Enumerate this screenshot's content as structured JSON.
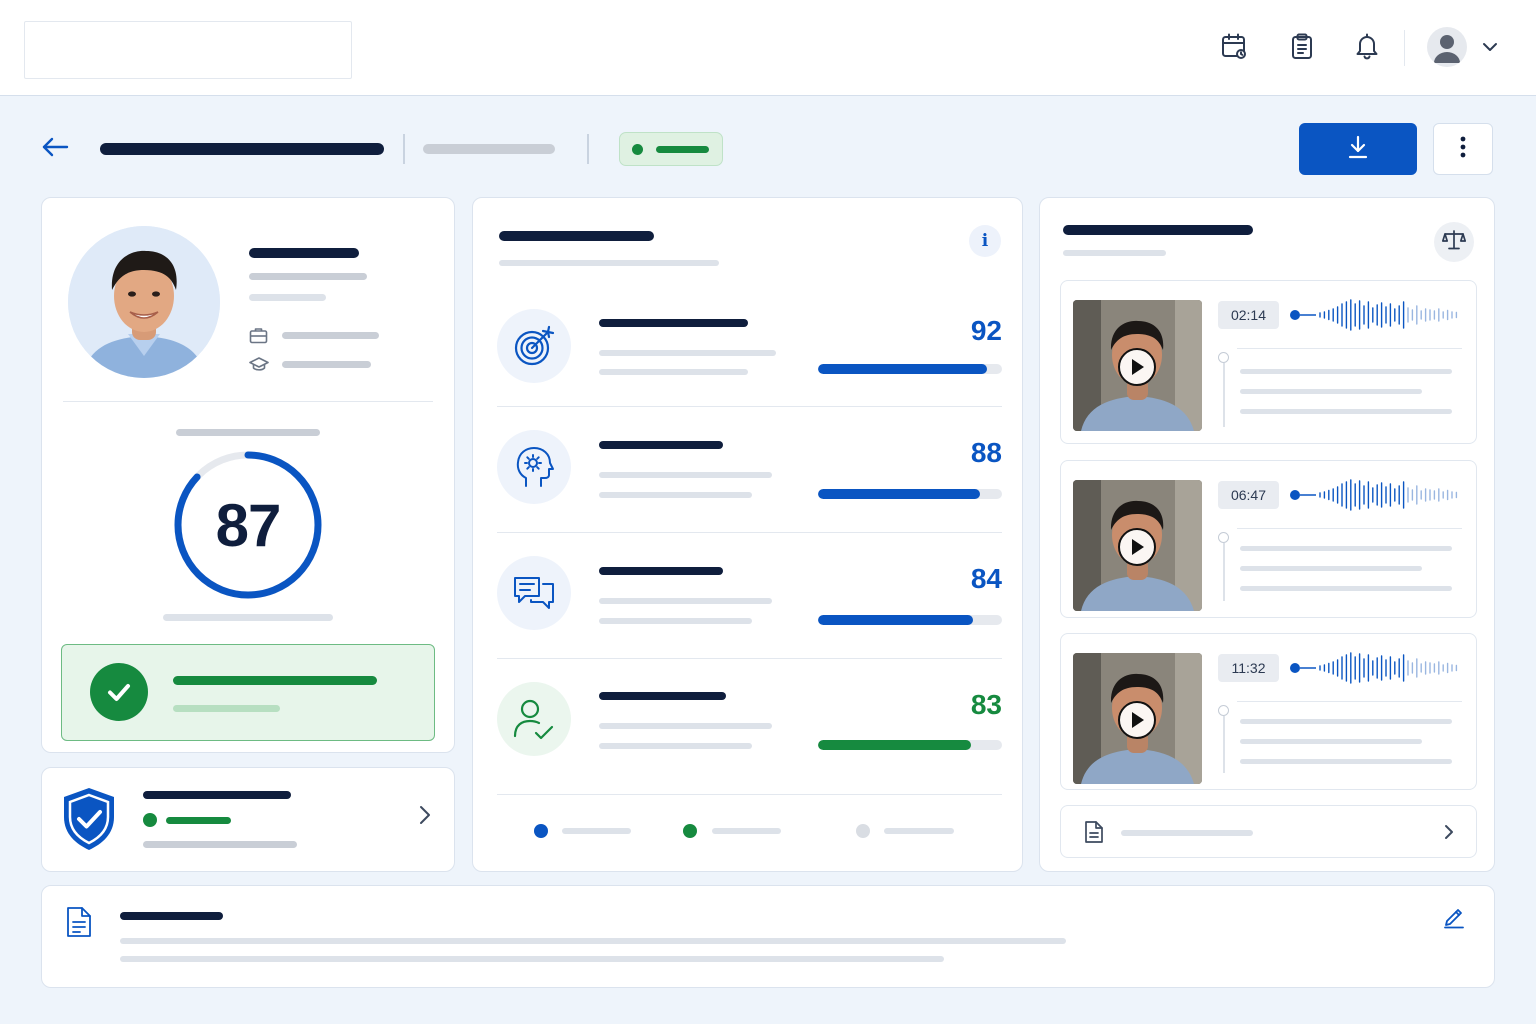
{
  "header": {
    "icons": [
      "calendar-icon",
      "clipboard-icon",
      "bell-icon",
      "user-avatar-icon",
      "chevron-down-icon"
    ]
  },
  "toolbar": {
    "back_icon": "arrow-left-icon",
    "download_icon": "download-icon",
    "more_icon": "more-vertical-icon"
  },
  "profile": {
    "score": "87",
    "score_fraction": 0.87,
    "detail_icons": [
      "briefcase-icon",
      "graduation-cap-icon"
    ]
  },
  "metrics": [
    {
      "score": "92",
      "fraction": 0.92,
      "icon": "target-icon",
      "color": "#0a55c2"
    },
    {
      "score": "88",
      "fraction": 0.88,
      "icon": "brain-gear-icon",
      "color": "#0a55c2"
    },
    {
      "score": "84",
      "fraction": 0.84,
      "icon": "chat-bubbles-icon",
      "color": "#0a55c2"
    },
    {
      "score": "83",
      "fraction": 0.83,
      "icon": "user-check-icon",
      "color": "#168a3f"
    }
  ],
  "legend": {
    "colors": [
      "#0a55c2",
      "#168a3f",
      "#d9dde3"
    ]
  },
  "clips": [
    {
      "time": "02:14"
    },
    {
      "time": "06:47"
    },
    {
      "time": "11:32"
    }
  ],
  "colors": {
    "accent": "#0a55c2",
    "success": "#168a3f",
    "navy": "#0f1e3d"
  }
}
